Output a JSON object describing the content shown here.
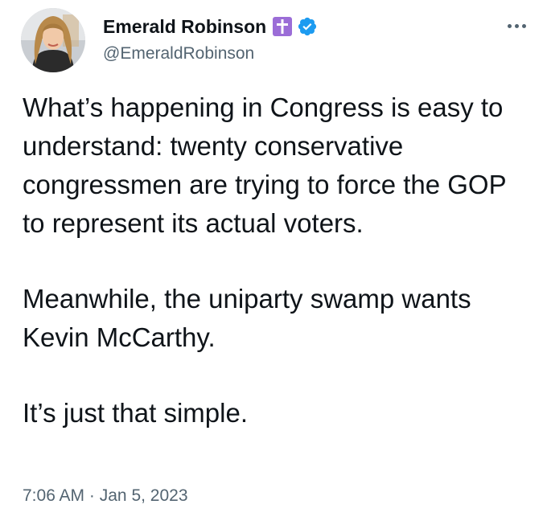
{
  "author": {
    "display_name": "Emerald Robinson",
    "handle": "@EmeraldRobinson",
    "badges": [
      "latin-cross-icon",
      "verified-badge-icon"
    ]
  },
  "tweet": {
    "paragraphs": [
      "What’s happening in Congress is easy to understand: twenty conservative congressmen are trying to force the GOP to represent its actual voters.",
      "Meanwhile, the uniparty swamp wants Kevin McCarthy.",
      "It’s just that simple."
    ],
    "time": "7:06 AM",
    "separator": "·",
    "date": "Jan 5, 2023"
  },
  "colors": {
    "text": "#0f1419",
    "secondary": "#536471",
    "verified_blue": "#1d9bf0",
    "cross_badge": "#9b6dd7"
  },
  "icons": {
    "more": "more-options-icon"
  }
}
